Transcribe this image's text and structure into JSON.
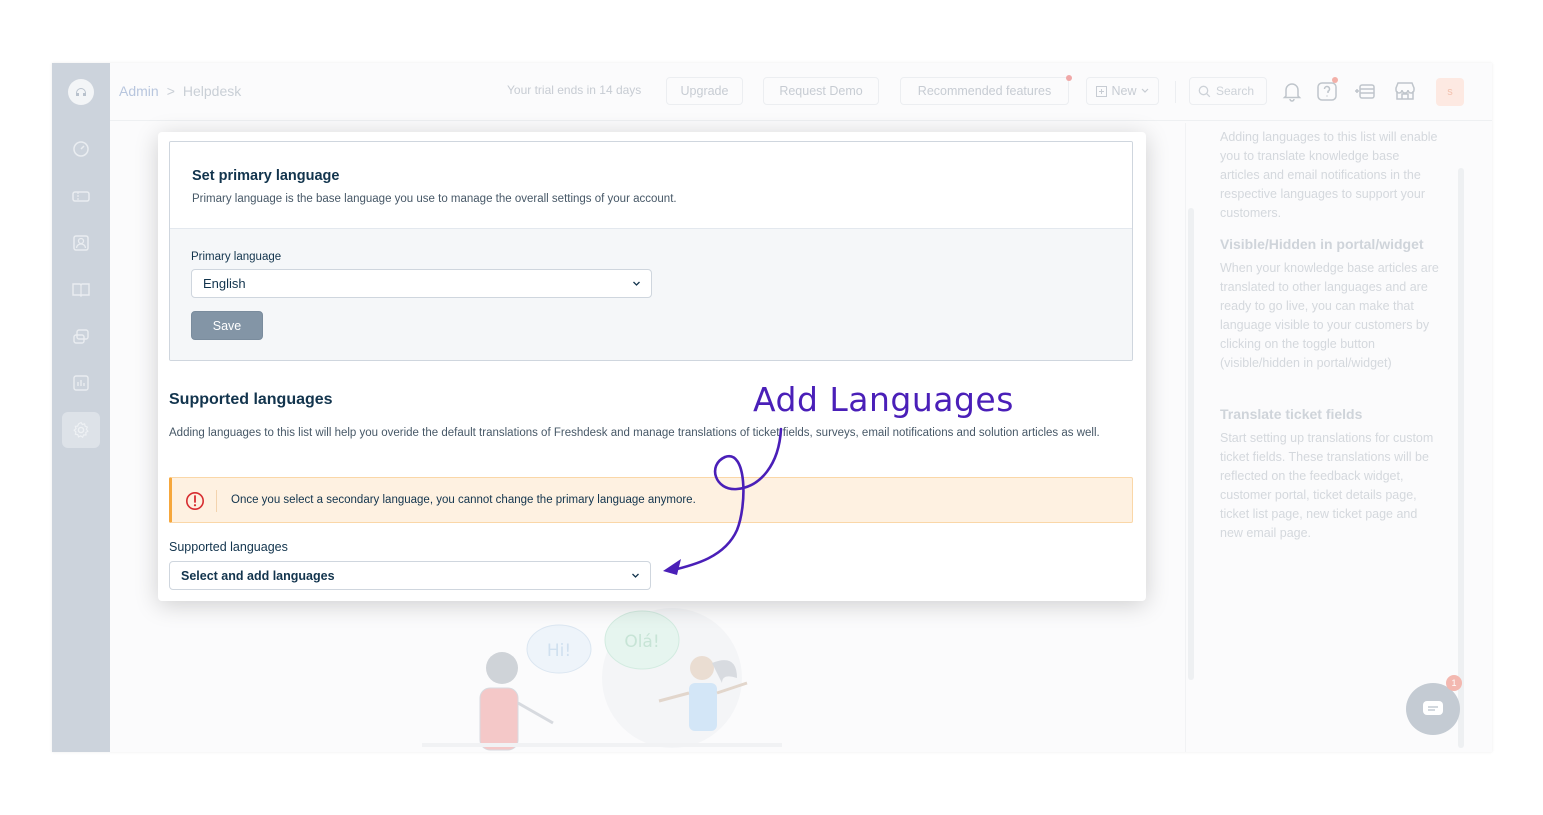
{
  "topbar": {
    "breadcrumb_root": "Admin",
    "breadcrumb_sep": ">",
    "breadcrumb_current": "Helpdesk",
    "trial_text": "Your trial ends in 14 days",
    "upgrade_label": "Upgrade",
    "request_demo_label": "Request Demo",
    "recommended_label": "Recommended features",
    "new_label": "New",
    "search_placeholder": "Search",
    "avatar_initial": "s"
  },
  "sidebar": {
    "items": [
      "dashboard-icon",
      "tickets-icon",
      "contacts-icon",
      "solutions-icon",
      "forums-icon",
      "reports-icon",
      "admin-settings-icon"
    ]
  },
  "primary_card": {
    "title": "Set primary language",
    "subtitle": "Primary language is the base language you use to manage the overall settings of your account.",
    "field_label": "Primary language",
    "selected_value": "English",
    "save_label": "Save"
  },
  "supported": {
    "title": "Supported languages",
    "description": "Adding languages to this list will help you overide the default translations of Freshdesk and manage translations of ticket fields, surveys, email notifications and solution articles as well.",
    "warning": "Once you select a secondary language, you cannot change the primary language anymore.",
    "field_label": "Supported languages",
    "placeholder": "Select and add languages"
  },
  "annotation": {
    "text": "Add Languages"
  },
  "help_panel": {
    "intro": "Adding languages to this list will enable you to translate knowledge base articles and email notifications in the respective languages to support your customers.",
    "section1_title": "Visible/Hidden in portal/widget",
    "section1_text": "When your knowledge base articles are translated to other languages and are ready to go live, you can make that language visible to your customers by clicking on the toggle button (visible/hidden in portal/widget)",
    "section2_title": "Translate ticket fields",
    "section2_text": "Start setting up translations for custom ticket fields. These translations will be reflected on the feedback widget, customer portal, ticket details page, ticket list page, new ticket page and new email page."
  },
  "illustration": {
    "bubble1": "Hi!",
    "bubble2": "Olá!"
  },
  "chat": {
    "badge_count": "1"
  },
  "colors": {
    "accent_annotation": "#4a1fb8",
    "text_primary": "#12344d",
    "save_button": "#8395a6",
    "warning_bg": "#fef1e1",
    "warning_border": "#f6a73c",
    "warning_icon": "#d72d30"
  }
}
